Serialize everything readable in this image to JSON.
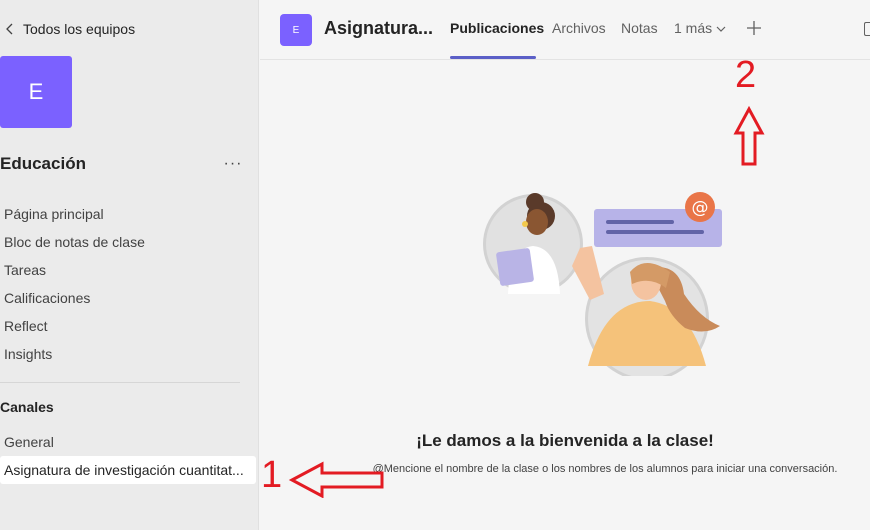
{
  "sidebar": {
    "back_label": "Todos los equipos",
    "team_initial": "E",
    "team_name": "Educación",
    "more_label": "···",
    "items": [
      {
        "label": "Página principal"
      },
      {
        "label": "Bloc de notas de clase"
      },
      {
        "label": "Tareas"
      },
      {
        "label": "Calificaciones"
      },
      {
        "label": "Reflect"
      },
      {
        "label": "Insights"
      }
    ],
    "channels_header": "Canales",
    "channels": [
      {
        "label": "General"
      },
      {
        "label": "Asignatura de investigación cuantitat..."
      }
    ]
  },
  "header": {
    "channel_initial": "E",
    "channel_title": "Asignatura...",
    "tabs": [
      {
        "label": "Publicaciones"
      },
      {
        "label": "Archivos"
      },
      {
        "label": "Notas"
      },
      {
        "label": "1 más"
      }
    ]
  },
  "main": {
    "welcome_title": "¡Le damos a la bienvenida a la clase!",
    "welcome_subtitle": "@Mencione el nombre de la clase o los nombres de los alumnos para iniciar una conversación."
  },
  "annotations": {
    "marker_1": "1",
    "marker_2": "2"
  },
  "colors": {
    "accent": "#5b5fc7",
    "avatar": "#7b61ff",
    "annotation": "#e31b23"
  }
}
